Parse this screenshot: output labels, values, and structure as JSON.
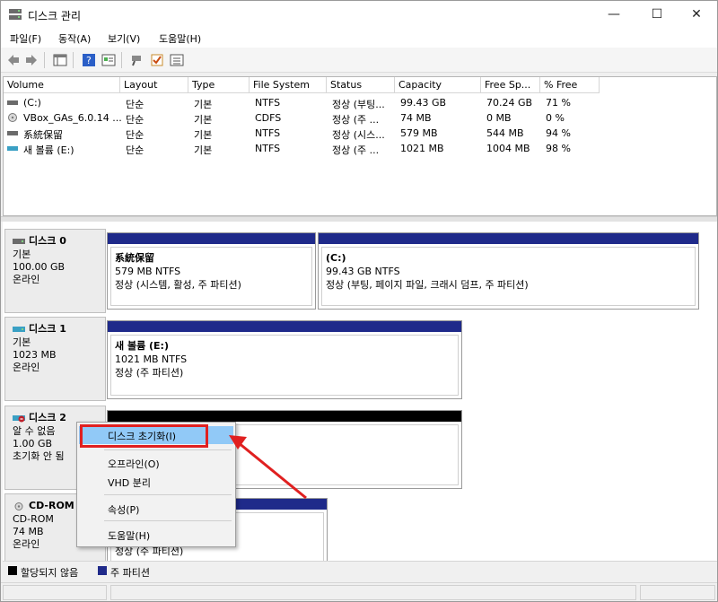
{
  "window": {
    "title": "디스크 관리",
    "controls": [
      "—",
      "☐",
      "✕"
    ]
  },
  "menu": [
    "파일(F)",
    "동작(A)",
    "보기(V)",
    "도움말(H)"
  ],
  "volume_list": {
    "columns": [
      "Volume",
      "Layout",
      "Type",
      "File System",
      "Status",
      "Capacity",
      "Free Sp...",
      "% Free"
    ],
    "rows": [
      {
        "volume": "(C:)",
        "layout": "단순",
        "type": "기본",
        "fs": "NTFS",
        "status": "정상 (부팅...",
        "capacity": "99.43 GB",
        "free": "70.24 GB",
        "pct": "71 %"
      },
      {
        "volume": "VBox_GAs_6.0.14 ...",
        "layout": "단순",
        "type": "기본",
        "fs": "CDFS",
        "status": "정상 (주 ...",
        "capacity": "74 MB",
        "free": "0 MB",
        "pct": "0 %"
      },
      {
        "volume": "系統保留",
        "layout": "단순",
        "type": "기본",
        "fs": "NTFS",
        "status": "정상 (시스...",
        "capacity": "579 MB",
        "free": "544 MB",
        "pct": "94 %"
      },
      {
        "volume": "새 볼륨 (E:)",
        "layout": "단순",
        "type": "기본",
        "fs": "NTFS",
        "status": "정상 (주 ...",
        "capacity": "1021 MB",
        "free": "1004 MB",
        "pct": "98 %"
      }
    ]
  },
  "disks": [
    {
      "name": "디스크 0",
      "type": "기본",
      "size": "100.00 GB",
      "state": "온라인",
      "partitions": [
        {
          "title": "系統保留",
          "info": "579 MB NTFS",
          "status": "정상 (시스템, 활성, 주 파티션)"
        },
        {
          "title": "(C:)",
          "info": "99.43 GB NTFS",
          "status": "정상 (부팅, 페이지 파일, 크래시 덤프, 주 파티션)"
        }
      ]
    },
    {
      "name": "디스크 1",
      "type": "기본",
      "size": "1023 MB",
      "state": "온라인",
      "partitions": [
        {
          "title": "새 볼륨  (E:)",
          "info": "1021 MB NTFS",
          "status": "정상 (주 파티션)"
        }
      ]
    },
    {
      "name": "디스크 2",
      "type": "알 수 없음",
      "size": "1.00 GB",
      "state": "초기화 안 됨"
    },
    {
      "name": "CD-ROM",
      "type": "CD-ROM",
      "size": "74 MB",
      "state": "온라인",
      "partitions": [
        {
          "status": "정상 (주 파티션)"
        }
      ]
    }
  ],
  "legend": [
    {
      "label": "할당되지 않음",
      "color": "#000000"
    },
    {
      "label": "주 파티션",
      "color": "#1f2a8a"
    }
  ],
  "context_menu": {
    "items": [
      {
        "label": "디스크 초기화(I)",
        "highlighted": true
      },
      {
        "label": "오프라인(O)"
      },
      {
        "label": "VHD 분리"
      },
      {
        "label": "속성(P)"
      },
      {
        "label": "도움말(H)"
      }
    ]
  },
  "colors": {
    "primary_partition": "#1f2a8a",
    "unallocated": "#000000",
    "highlight": "#e02020",
    "menu_hover": "#91c9f7"
  }
}
